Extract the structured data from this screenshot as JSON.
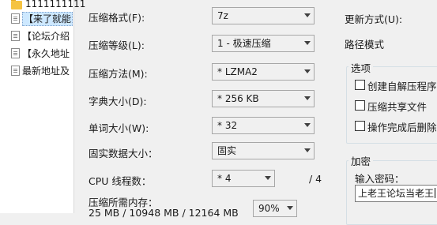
{
  "tree": {
    "root": "1111111111",
    "items": [
      "【来了就能",
      "【论坛介绍",
      "【永久地址",
      "最新地址及"
    ]
  },
  "form": {
    "format_label": "压缩格式(F):",
    "format_value": "7z",
    "level_label": "压缩等级(L):",
    "level_value": "1 - 极速压缩",
    "method_label": "压缩方法(M):",
    "method_value": "* LZMA2",
    "dict_label": "字典大小(D):",
    "dict_value": "* 256 KB",
    "word_label": "单词大小(W):",
    "word_value": "* 32",
    "solid_label": "固实数据大小：",
    "solid_value": "固实",
    "cpu_label": "CPU 线程数：",
    "cpu_value": "* 4",
    "cpu_total": "/ 4",
    "memory_label": "压缩所需内存：",
    "memory_value": "25 MB / 10948 MB / 12164 MB",
    "memory_percent": "90%"
  },
  "right": {
    "update_label": "更新方式(U):",
    "path_label": "路径模式",
    "options_title": "选项",
    "options": [
      "创建自解压程序(X",
      "压缩共享文件",
      "操作完成后删除源"
    ],
    "encrypt_title": "加密",
    "password_label": "输入密码：",
    "password_value": "上老王论坛当老王"
  }
}
